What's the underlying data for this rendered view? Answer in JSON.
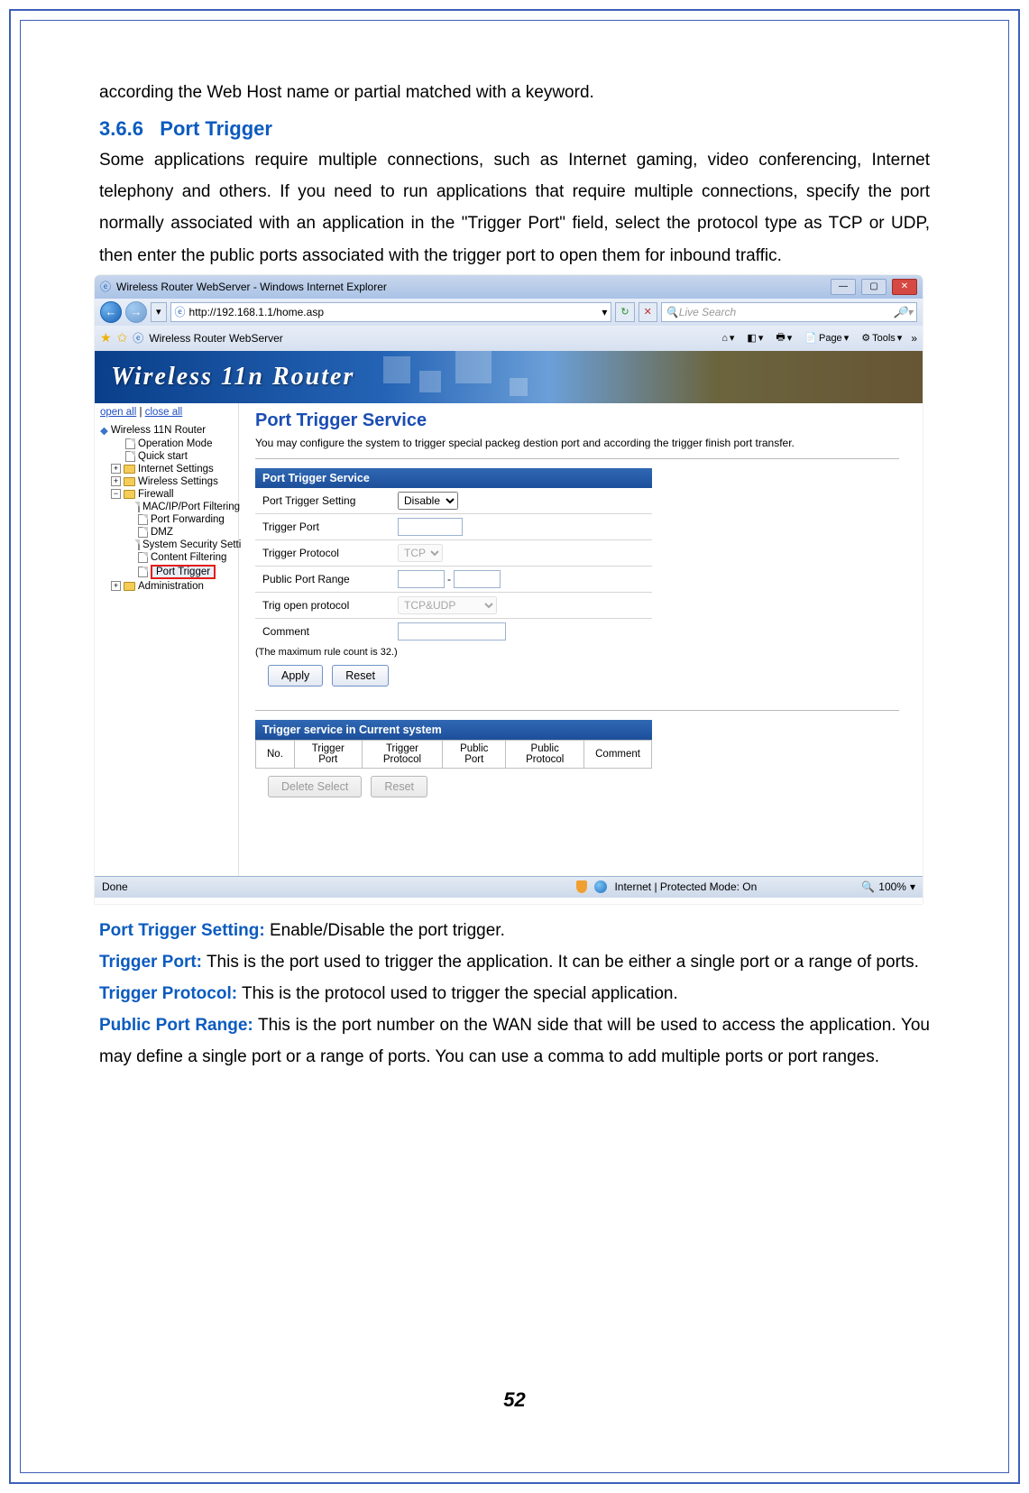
{
  "doc": {
    "intro_line": "according the Web Host name or partial matched with a keyword.",
    "sec_number": "3.6.6",
    "sec_title": "Port Trigger",
    "sec_body": "Some applications require multiple connections, such as Internet gaming, video conferencing, Internet telephony and others. If you need to run applications that require multiple connections, specify the port normally associated with an application in the \"Trigger Port\" field, select the protocol type as TCP or UDP, then enter the public ports associated with the trigger port to open them for inbound traffic.",
    "defs": [
      {
        "term": "Port Trigger Setting:",
        "text": " Enable/Disable the port trigger."
      },
      {
        "term": "Trigger Port:",
        "text": " This is the port used to trigger the application. It can be either a single port or a range of ports."
      },
      {
        "term": "Trigger Protocol:",
        "text": " This is the protocol used to trigger the special application."
      },
      {
        "term": "Public Port Range:",
        "text": " This is the port number on the WAN side that will be used to access the application. You may define a single port or a range of ports. You can use a comma to add multiple ports or port ranges."
      }
    ],
    "page_number": "52"
  },
  "browser": {
    "window_title": "Wireless Router WebServer - Windows Internet Explorer",
    "url": "http://192.168.1.1/home.asp",
    "search_placeholder": "Live Search",
    "tab_title": "Wireless Router WebServer",
    "tool_page": "Page",
    "tool_tools": "Tools",
    "status_left": "Done",
    "status_mid": "Internet | Protected Mode: On",
    "zoom": "100%"
  },
  "banner": {
    "text": "Wireless 11n Router"
  },
  "sidebar": {
    "open_all": "open all",
    "close_all": "close all",
    "root": "Wireless 11N Router",
    "items_l1": [
      "Operation Mode",
      "Quick start"
    ],
    "groups": [
      "Internet Settings",
      "Wireless Settings"
    ],
    "firewall_label": "Firewall",
    "firewall_children": [
      "MAC/IP/Port Filtering",
      "Port Forwarding",
      "DMZ",
      "System Security Setti",
      "Content Filtering",
      "Port Trigger"
    ],
    "admin_label": "Administration"
  },
  "router": {
    "page_title": "Port Trigger Service",
    "page_desc": "You may configure the system to trigger special packeg destion port and according the trigger finish port transfer.",
    "form_head": "Port Trigger Service",
    "rows": {
      "setting_label": "Port Trigger Setting",
      "setting_value": "Disable",
      "trigger_port_label": "Trigger Port",
      "trigger_proto_label": "Trigger Protocol",
      "trigger_proto_value": "TCP",
      "public_range_label": "Public Port Range",
      "public_range_dash": "-",
      "open_proto_label": "Trig open protocol",
      "open_proto_value": "TCP&UDP",
      "comment_label": "Comment"
    },
    "max_note": "(The maximum rule count is 32.)",
    "apply": "Apply",
    "reset": "Reset",
    "cur_head": "Trigger service in Current system",
    "cur_cols": [
      "No.",
      "Trigger Port",
      "Trigger Protocol",
      "Public Port",
      "Public Protocol",
      "Comment"
    ],
    "delete_select": "Delete Select",
    "reset2": "Reset"
  }
}
